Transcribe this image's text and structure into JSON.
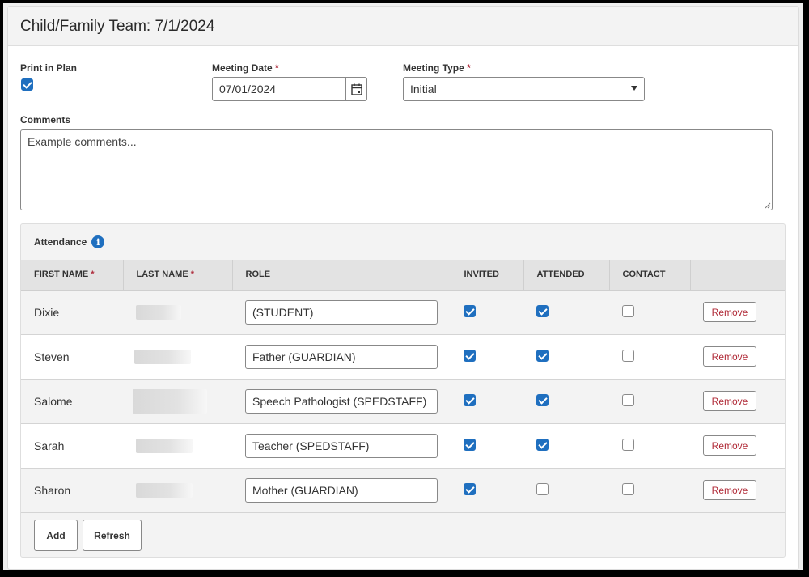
{
  "header": {
    "title": "Child/Family Team: 7/1/2024"
  },
  "form": {
    "print_in_plan": {
      "label": "Print in Plan",
      "checked": true
    },
    "meeting_date": {
      "label": "Meeting Date",
      "required_mark": "*",
      "value": "07/01/2024",
      "icon": "calendar-icon"
    },
    "meeting_type": {
      "label": "Meeting Type",
      "required_mark": "*",
      "value": "Initial",
      "icon": "caret-down-icon"
    },
    "comments": {
      "label": "Comments",
      "value": "Example comments..."
    }
  },
  "attendance": {
    "title": "Attendance",
    "info_icon": "i",
    "columns": [
      {
        "label": "FIRST NAME",
        "required_mark": "*"
      },
      {
        "label": "LAST NAME",
        "required_mark": "*"
      },
      {
        "label": "ROLE"
      },
      {
        "label": "INVITED"
      },
      {
        "label": "ATTENDED"
      },
      {
        "label": "CONTACT"
      },
      {
        "label": ""
      }
    ],
    "rows": [
      {
        "first_name": "Dixie",
        "last_name": "[redacted]",
        "role": "(STUDENT)",
        "invited": true,
        "attended": true,
        "contact": false,
        "remove_label": "Remove"
      },
      {
        "first_name": "Steven",
        "last_name": "[redacted]",
        "role": "Father (GUARDIAN)",
        "invited": true,
        "attended": true,
        "contact": false,
        "remove_label": "Remove"
      },
      {
        "first_name": "Salome",
        "last_name": "[redacted]",
        "role": "Speech Pathologist (SPEDSTAFF)",
        "invited": true,
        "attended": true,
        "contact": false,
        "remove_label": "Remove"
      },
      {
        "first_name": "Sarah",
        "last_name": "[redacted]",
        "role": "Teacher (SPEDSTAFF)",
        "invited": true,
        "attended": true,
        "contact": false,
        "remove_label": "Remove"
      },
      {
        "first_name": "Sharon",
        "last_name": "[redacted]",
        "role": "Mother (GUARDIAN)",
        "invited": true,
        "attended": false,
        "contact": false,
        "remove_label": "Remove"
      }
    ],
    "add_label": "Add",
    "refresh_label": "Refresh"
  },
  "colors": {
    "accent": "#1f6fbf",
    "danger": "#b02a37"
  }
}
